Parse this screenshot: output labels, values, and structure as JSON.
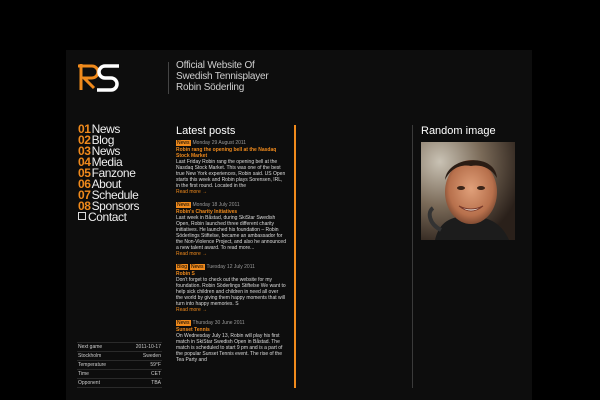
{
  "site": {
    "tagline": [
      "Official Website Of",
      "Swedish Tennisplayer",
      "Robin Söderling"
    ]
  },
  "nav": [
    {
      "num": "01",
      "label": "News"
    },
    {
      "num": "02",
      "label": "Blog"
    },
    {
      "num": "03",
      "label": "News"
    },
    {
      "num": "04",
      "label": "Media"
    },
    {
      "num": "05",
      "label": "Fanzone"
    },
    {
      "num": "06",
      "label": "About"
    },
    {
      "num": "07",
      "label": "Schedule"
    },
    {
      "num": "08",
      "label": "Sponsors"
    },
    {
      "num": "",
      "label": "Contact"
    }
  ],
  "info": [
    {
      "label": "Next game",
      "value": "2011-10-17"
    },
    {
      "label": "Stockholm",
      "value": "Sweden"
    },
    {
      "label": "Temperature",
      "value": "59°F"
    },
    {
      "label": "Time",
      "value": "CET"
    },
    {
      "label": "Opponent",
      "value": "TBA"
    }
  ],
  "latest": {
    "heading": "Latest posts",
    "posts": [
      {
        "tags": [
          "News"
        ],
        "date": "Monday 29 August 2011",
        "title": "Robin rang the opening bell at the Nasdaq Stock Market",
        "body": "Last Friday Robin rang the opening bell at the Nasdaq Stock Market. This was one of the best true New York experiences, Robin said. US Open starts this week and Robin plays Sorensen, IRL, in the first round. Located in the",
        "more": "Read more →"
      },
      {
        "tags": [
          "News"
        ],
        "date": "Monday 18 July 2011",
        "title": "Robin's Charity Initiatives",
        "body": "Last week in Båstad, during SkiStar Swedish Open, Robin launched three different charity initiatives. He launched his foundation – Robin Söderlings Stiftelse, became an ambassador for the Non-Violence Project, and also he announced a new talent award. To read more...",
        "more": "Read more →"
      },
      {
        "tags": [
          "Blog",
          "News"
        ],
        "date": "Tuesday 12 July 2011",
        "title": "Robin S",
        "body": "Don't forget to check out the website for my foundation. Robin Söderlings Stiftelse We want to help sick children and children in need all over the world by giving them happy moments that will turn into happy memories. S",
        "more": "Read more →"
      },
      {
        "tags": [
          "News"
        ],
        "date": "Thursday 30 June 2011",
        "title": "Sunset Tennis",
        "body": "On Wednesday July 13, Robin will play his first match in SkiStar Swedish Open in Båstad. The match is scheduled to start 9 pm and is a part of the popular Sunset Tennis event. The rise of the Tea Party and",
        "more": ""
      }
    ]
  },
  "random": {
    "heading": "Random image"
  },
  "colors": {
    "accent": "#f08a1c",
    "background": "#000000",
    "panel": "#0d0d0d"
  }
}
